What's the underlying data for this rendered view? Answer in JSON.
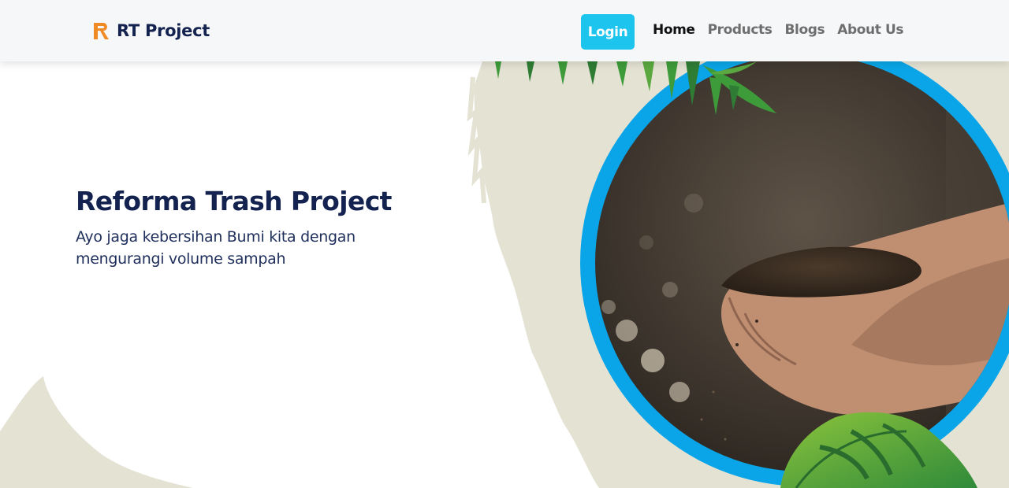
{
  "navbar": {
    "brand_name": "RT Project",
    "login_label": "Login",
    "links": [
      {
        "label": "Home",
        "active": true
      },
      {
        "label": "Products",
        "active": false
      },
      {
        "label": "Blogs",
        "active": false
      },
      {
        "label": "About Us",
        "active": false
      }
    ]
  },
  "hero": {
    "title": "Reforma Trash Project",
    "subtitle_line1": "Ayo jaga kebersihan Bumi kita dengan",
    "subtitle_line2": "mengurangi volume sampah",
    "image_icon": "hands-holding-soil-image"
  },
  "colors": {
    "brand_navy": "#13224f",
    "accent_cyan": "#1cc4ee",
    "ring_blue": "#0aa5e8",
    "logo_orange": "#f08a24",
    "paint_beige": "#e3e2d3",
    "leaf_green": "#3e9b3a"
  }
}
